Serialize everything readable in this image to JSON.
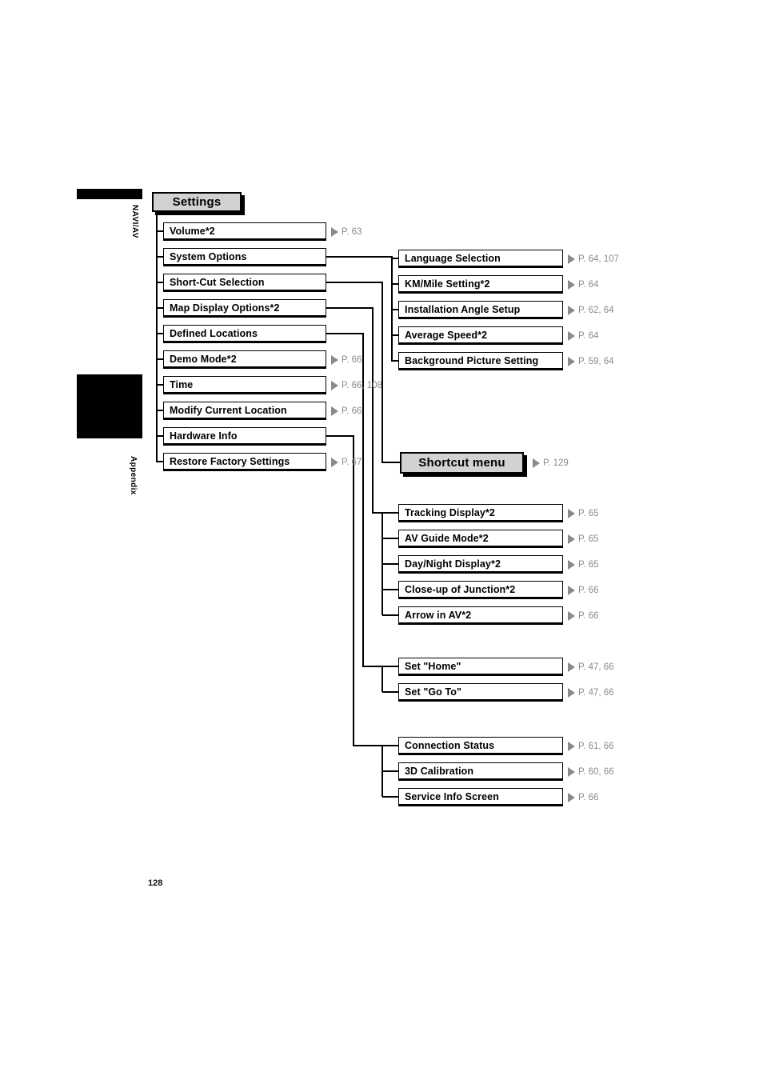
{
  "page": {
    "number": "128",
    "side_tabs": [
      {
        "label": "NAVI/AV"
      },
      {
        "label": "Appendix"
      }
    ]
  },
  "colors": {
    "chip_fill": "#d2d2d2",
    "chip_border": "#000000",
    "box_fill": "#ffffff",
    "box_border": "#000000",
    "reference_text": "#8a8a8a",
    "reference_arrow": "#8a8a8a",
    "tab_fill": "#000000"
  },
  "headings": {
    "settings": "Settings",
    "shortcut_menu": "Shortcut menu",
    "shortcut_menu_ref": "P. 129"
  },
  "columns": {
    "settings_items": [
      {
        "label": "Volume*2",
        "ref": "P. 63",
        "has_children": false
      },
      {
        "label": "System Options",
        "ref": "",
        "has_children": true
      },
      {
        "label": "Short-Cut Selection",
        "ref": "",
        "has_children": true
      },
      {
        "label": "Map Display Options*2",
        "ref": "",
        "has_children": true
      },
      {
        "label": "Defined Locations",
        "ref": "",
        "has_children": true
      },
      {
        "label": "Demo Mode*2",
        "ref": "P. 66",
        "has_children": false
      },
      {
        "label": "Time",
        "ref": "P. 66, 108",
        "has_children": false
      },
      {
        "label": "Modify Current Location",
        "ref": "P. 66",
        "has_children": false
      },
      {
        "label": "Hardware Info",
        "ref": "",
        "has_children": true
      },
      {
        "label": "Restore Factory Settings",
        "ref": "P. 67",
        "has_children": false
      }
    ],
    "system_options_children": [
      {
        "label": "Language Selection",
        "ref": "P. 64, 107"
      },
      {
        "label": "KM/Mile Setting*2",
        "ref": "P. 64"
      },
      {
        "label": "Installation Angle Setup",
        "ref": "P. 62, 64"
      },
      {
        "label": "Average Speed*2",
        "ref": "P. 64"
      },
      {
        "label": "Background Picture Setting",
        "ref": "P. 59, 64"
      }
    ],
    "map_display_children": [
      {
        "label": "Tracking Display*2",
        "ref": "P. 65"
      },
      {
        "label": "AV Guide Mode*2",
        "ref": "P. 65"
      },
      {
        "label": "Day/Night Display*2",
        "ref": "P. 65"
      },
      {
        "label": "Close-up of Junction*2",
        "ref": "P. 66"
      },
      {
        "label": "Arrow in AV*2",
        "ref": "P. 66"
      }
    ],
    "defined_locations_children": [
      {
        "label": "Set \"Home\"",
        "ref": "P. 47, 66"
      },
      {
        "label": "Set \"Go To\"",
        "ref": "P. 47, 66"
      }
    ],
    "hardware_info_children": [
      {
        "label": "Connection Status",
        "ref": "P. 61, 66"
      },
      {
        "label": "3D Calibration",
        "ref": "P. 60, 66"
      },
      {
        "label": "Service Info Screen",
        "ref": "P. 66"
      }
    ]
  }
}
